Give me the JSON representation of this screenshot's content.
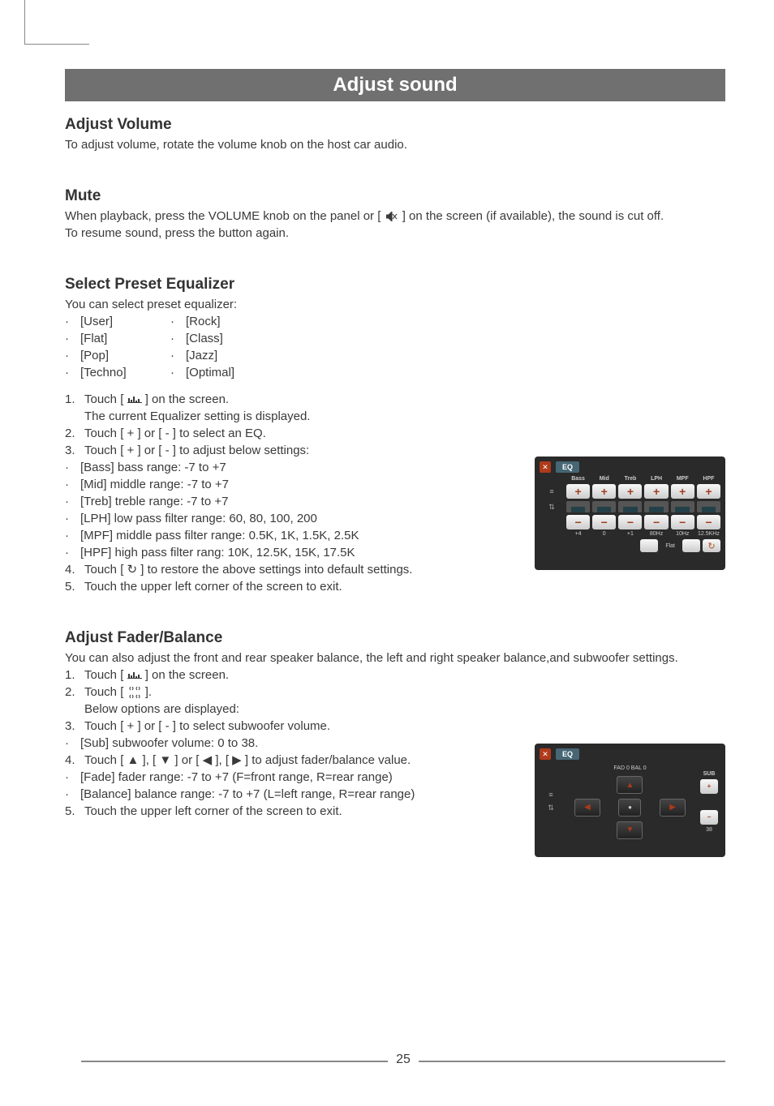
{
  "header": "Adjust sound",
  "section_volume": {
    "title": "Adjust Volume",
    "text": "To adjust volume, rotate the volume knob on the host car audio."
  },
  "section_mute": {
    "title": "Mute",
    "text1a": "When playback, press the VOLUME knob on the panel or [ ",
    "text1b": " ] on the screen (if available), the sound is cut off.",
    "text2": "To resume sound, press the button again."
  },
  "section_eq": {
    "title": "Select Preset Equalizer",
    "intro": "You can select preset equalizer:",
    "col1": [
      "[User]",
      "[Flat]",
      "[Pop]",
      "[Techno]"
    ],
    "col2": [
      "[Rock]",
      "[Class]",
      "[Jazz]",
      "[Optimal]"
    ],
    "step1a": "Touch [ ",
    "step1b": " ] on the screen.",
    "step1c": "The current Equalizer setting is displayed.",
    "step2": "Touch [ + ] or [ - ] to select an EQ.",
    "step3": "Touch [ + ] or [ - ] to adjust below settings:",
    "sub_bass": " [Bass] bass range: -7 to +7",
    "sub_mid": " [Mid] middle range: -7 to +7",
    "sub_treb": " [Treb] treble range: -7 to +7",
    "sub_lph": " [LPH] low pass filter range: 60, 80, 100, 200",
    "sub_mpf": " [MPF] middle pass filter range: 0.5K, 1K, 1.5K, 2.5K",
    "sub_hpf": " [HPF] high pass filter rang: 10K, 12.5K, 15K, 17.5K",
    "step4a": "Touch [ ",
    "step4b": " ] to restore the above settings into default settings.",
    "step5": "Touch the upper left corner of the screen to exit."
  },
  "section_fb": {
    "title": "Adjust Fader/Balance",
    "intro": "You can also adjust the front and rear speaker balance, the left and right speaker balance,and subwoofer settings.",
    "step1a": "Touch [ ",
    "step1b": " ] on the screen.",
    "step2a": "Touch [ ",
    "step2b": " ].",
    "step2c": "Below options are displayed:",
    "step3": "Touch [ + ] or [ - ] to select subwoofer volume.",
    "sub_sub": " [Sub] subwoofer volume: 0 to 38.",
    "step4a": "Touch [ ",
    "step4b": " ], [ ",
    "step4c": " ] or [ ",
    "step4d": " ], [ ",
    "step4e": " ] to adjust fader/balance value.",
    "sub_fade": " [Fade] fader range: -7 to +7 (F=front range, R=rear range)",
    "sub_balance": " [Balance] balance range: -7 to +7 (L=left range, R=rear range)",
    "step5": "Touch the upper left corner of the screen to exit."
  },
  "screenshot_eq": {
    "title": "EQ",
    "headers": [
      "Bass",
      "Mid",
      "Treb",
      "LPH",
      "MPF",
      "HPF"
    ],
    "vals": [
      "+4",
      "0",
      "+1",
      "80Hz",
      "10Hz",
      "12.5KHz"
    ],
    "flat": "Flat"
  },
  "screenshot_fb": {
    "title": "EQ",
    "label": "FAD 0  BAL 0",
    "sub": "SUB",
    "sub_val": "38"
  },
  "page_number": "25",
  "bullet": "·"
}
